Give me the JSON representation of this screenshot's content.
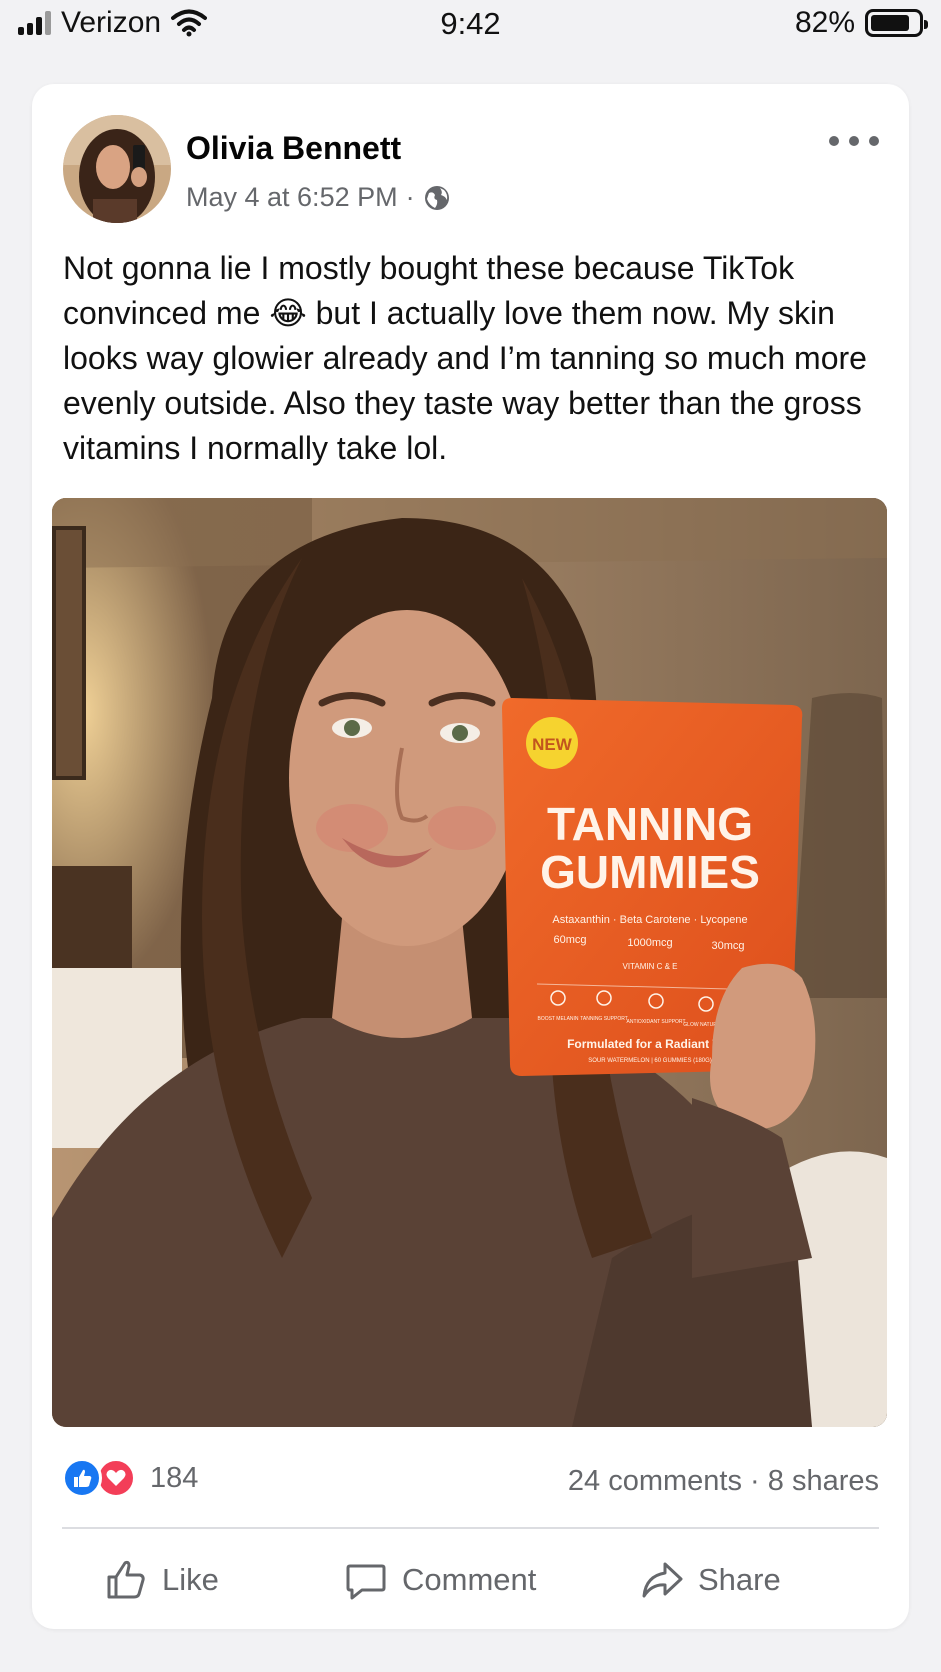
{
  "status_bar": {
    "carrier": "Verizon",
    "time": "9:42",
    "battery": "82%",
    "battery_level": 0.82
  },
  "post": {
    "author": "Olivia Bennett",
    "timestamp": "May 4 at 6:52 PM",
    "separator": "·",
    "privacy_icon": "globe-icon",
    "text": "Not gonna lie I mostly bought these because TikTok convinced me 😂 but I actually love them now. My skin looks way glowier already and I’m tanning so much more evenly outside. Also they taste way better than the gross vitamins I normally take lol.",
    "product": {
      "badge": "NEW",
      "title_line1": "TANNING",
      "title_line2": "GUMMIES",
      "ingredients": "Astaxanthin · Beta Carotene · Lycopene",
      "doses": [
        "60mcg",
        "1000mcg",
        "30mcg"
      ],
      "vitamins": "VITAMIN C & E",
      "benefits": [
        "BOOST MELANIN",
        "TANNING SUPPORT",
        "ANTIOXIDANT SUPPORT",
        "GLOW NATURALLY"
      ],
      "tagline": "Formulated for a Radiant Tan",
      "footer": "SOUR WATERMELON | 60 GUMMIES (180G)"
    }
  },
  "engagement": {
    "reaction_count": "184",
    "comments": "24 comments",
    "dot": "·",
    "shares": "8 shares",
    "reaction_icons": [
      "like-icon",
      "love-icon"
    ]
  },
  "actions": {
    "like": "Like",
    "comment": "Comment",
    "share": "Share"
  },
  "colors": {
    "facebook_blue": "#1877f2",
    "love_red": "#f33e58",
    "meta_gray": "#65676b",
    "package_orange": "#ea5a22"
  }
}
